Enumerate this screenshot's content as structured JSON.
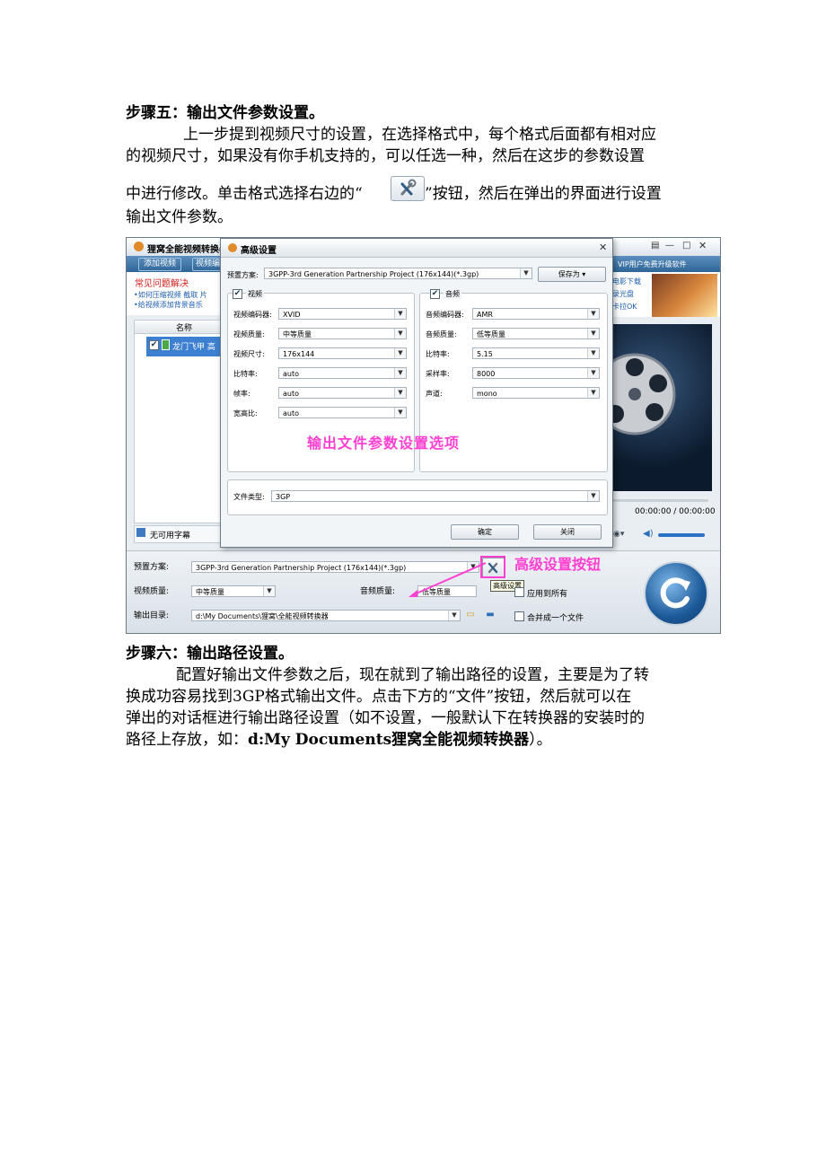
{
  "doc": {
    "step5_heading": "步骤五：输出文件参数设置。",
    "p1_line1": "上一步提到视频尺寸的设置，在选择格式中，每个格式后面都有相对应",
    "p1_line2": "的视频尺寸，如果没有你手机支持的，可以任选一种，然后在这步的参数设置",
    "p1_line3a": "中进行修改。单击格式选择右边的“",
    "p1_line3b": "”按钮，然后在弹出的界面进行设置",
    "p1_line4": "输出文件参数。",
    "step6_heading": "步骤六：输出路径设置。",
    "p2_line1": "配置好输出文件参数之后，现在就到了输出路径的设置，主要是为了转",
    "p2_line2": "换成功容易找到3GP格式输出文件。点击下方的“文件”按钮，然后就可以在",
    "p2_line3": "弹出的对话框进行输出路径设置（如不设置，一般默认下在转换器的安装时的",
    "p2_line4a": "路径上存放，如：",
    "p2_line4b": "d:My Documents狸窝全能视频转换器",
    "p2_line4c": "）。"
  },
  "app": {
    "title": "狸窝全能视频转换器",
    "add_video": "添加视频",
    "video_edit": "视频编",
    "vip_upgrade": "VIP用户免费升级软件",
    "faq_title": "常见问题解决",
    "faq1": "•如何压缩视频 截取 片",
    "faq2": "•给视频添加背景音乐",
    "ad1": "电影下载",
    "ad2": "录光盘",
    "ad3": "卡拉OK",
    "col_name": "名称",
    "file_name": "龙门飞甲 高",
    "subtitle_none": "无可用字幕",
    "time_display": "00:00:00 / 00:00:00",
    "preset_label": "预置方案:",
    "preset_value": "3GPP-3rd Generation Partnership Project (176x144)(*.3gp)",
    "video_quality_label": "视频质量:",
    "video_quality_value": "中等质量",
    "audio_quality_label": "音频质量:",
    "audio_quality_value": "低等质量",
    "apply_all": "应用到所有",
    "output_dir_label": "输出目录:",
    "output_dir_value": "d:\\My Documents\\狸窝\\全能视频转换器",
    "merge_one": "合并成一个文件",
    "adv_tooltip": "高级设置"
  },
  "dialog": {
    "title": "高级设置",
    "preset_label": "预置方案:",
    "preset_value": "3GPP-3rd Generation Partnership Project (176x144)(*.3gp)",
    "save_as": "保存为",
    "video_group": "视频",
    "audio_group": "音频",
    "video_fields": [
      {
        "label": "视频编码器:",
        "value": "XVID"
      },
      {
        "label": "视频质量:",
        "value": "中等质量"
      },
      {
        "label": "视频尺寸:",
        "value": "176x144"
      },
      {
        "label": "比特率:",
        "value": "auto"
      },
      {
        "label": "帧率:",
        "value": "auto"
      },
      {
        "label": "宽高比:",
        "value": "auto"
      }
    ],
    "audio_fields": [
      {
        "label": "音频编码器:",
        "value": "AMR"
      },
      {
        "label": "音频质量:",
        "value": "低等质量"
      },
      {
        "label": "比特率:",
        "value": "5.15"
      },
      {
        "label": "采样率:",
        "value": "8000"
      },
      {
        "label": "声道:",
        "value": "mono"
      }
    ],
    "file_type_label": "文件类型:",
    "file_type_value": "3GP",
    "ok": "确定",
    "close": "关闭"
  },
  "annotations": {
    "options_caption": "输出文件参数设置选项",
    "button_caption": "高级设置按钮",
    "color": "#ff3fd2"
  }
}
